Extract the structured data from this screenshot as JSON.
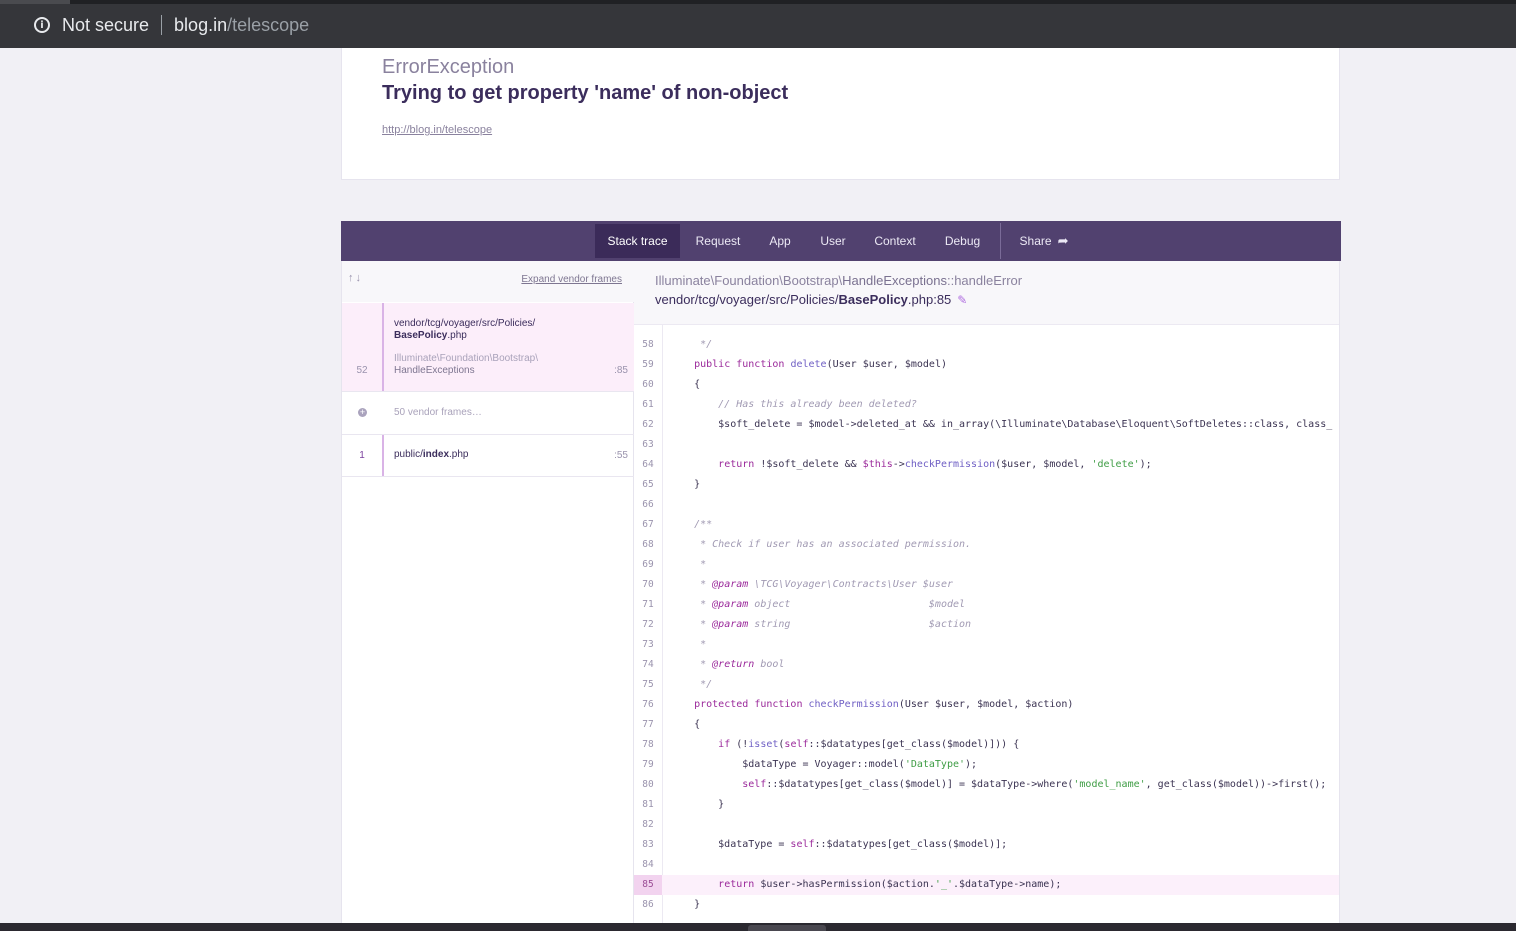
{
  "browser": {
    "security_label": "Not secure",
    "url_host": "blog.in",
    "url_path": "/telescope",
    "info_icon": "info-circle-icon"
  },
  "exception": {
    "class": "ErrorException",
    "message": "Trying to get property 'name' of non-object",
    "url": "http://blog.in/telescope"
  },
  "tabs": {
    "items": [
      {
        "label": "Stack trace",
        "active": true
      },
      {
        "label": "Request"
      },
      {
        "label": "App"
      },
      {
        "label": "User"
      },
      {
        "label": "Context"
      },
      {
        "label": "Debug"
      }
    ],
    "share_label": "Share",
    "share_icon": "share-arrow-icon"
  },
  "frames": {
    "arrows": "↑↓",
    "expand_label": "Expand vendor frames",
    "items": [
      {
        "number": "52",
        "path": "vendor/tcg/voyager/src/Policies/",
        "file": "BasePolicy",
        "ext": ".php",
        "class_prefix": "Illuminate\\Foundation\\Bootstrap\\",
        "class_name": "HandleExceptions",
        "line": ":85"
      },
      {
        "vendor_label": "50 vendor frames…"
      },
      {
        "number": "1",
        "path": "public/",
        "file": "index",
        "ext": ".php",
        "line": ":55"
      }
    ]
  },
  "code_header": {
    "class_prefix": "Illuminate\\Foundation\\Bootstrap\\",
    "class_name": "HandleExceptions",
    "method": "::handleError",
    "file_path": "vendor/tcg/voyager/src/Policies/",
    "file_name": "BasePolicy",
    "file_ext": ".php:85"
  },
  "code": {
    "highlight_line": 85,
    "lines": [
      {
        "n": "58",
        "t": "     */"
      },
      {
        "n": "59",
        "t": "    public function delete(User $user, $model)"
      },
      {
        "n": "60",
        "t": "    {"
      },
      {
        "n": "61",
        "t": "        // Has this already been deleted?"
      },
      {
        "n": "62",
        "t": "        $soft_delete = $model->deleted_at && in_array(\\Illuminate\\Database\\Eloquent\\SoftDeletes::class, class_"
      },
      {
        "n": "63",
        "t": ""
      },
      {
        "n": "64",
        "t": "        return !$soft_delete && $this->checkPermission($user, $model, 'delete');"
      },
      {
        "n": "65",
        "t": "    }"
      },
      {
        "n": "66",
        "t": ""
      },
      {
        "n": "67",
        "t": "    /**"
      },
      {
        "n": "68",
        "t": "     * Check if user has an associated permission."
      },
      {
        "n": "69",
        "t": "     *"
      },
      {
        "n": "70",
        "t": "     * @param \\TCG\\Voyager\\Contracts\\User $user"
      },
      {
        "n": "71",
        "t": "     * @param object                       $model"
      },
      {
        "n": "72",
        "t": "     * @param string                       $action"
      },
      {
        "n": "73",
        "t": "     *"
      },
      {
        "n": "74",
        "t": "     * @return bool"
      },
      {
        "n": "75",
        "t": "     */"
      },
      {
        "n": "76",
        "t": "    protected function checkPermission(User $user, $model, $action)"
      },
      {
        "n": "77",
        "t": "    {"
      },
      {
        "n": "78",
        "t": "        if (!isset(self::$datatypes[get_class($model)])) {"
      },
      {
        "n": "79",
        "t": "            $dataType = Voyager::model('DataType');"
      },
      {
        "n": "80",
        "t": "            self::$datatypes[get_class($model)] = $dataType->where('model_name', get_class($model))->first();"
      },
      {
        "n": "81",
        "t": "        }"
      },
      {
        "n": "82",
        "t": ""
      },
      {
        "n": "83",
        "t": "        $dataType = self::$datatypes[get_class($model)];"
      },
      {
        "n": "84",
        "t": ""
      },
      {
        "n": "85",
        "t": "        return $user->hasPermission($action.'_'.$dataType->name);"
      },
      {
        "n": "86",
        "t": "    }"
      }
    ]
  },
  "colors": {
    "accent": "#51416f",
    "accent_active": "#3b2b59",
    "highlight_bg": "#fcf0fb",
    "keyword": "#9b2a9b",
    "string": "#3f9d45"
  }
}
